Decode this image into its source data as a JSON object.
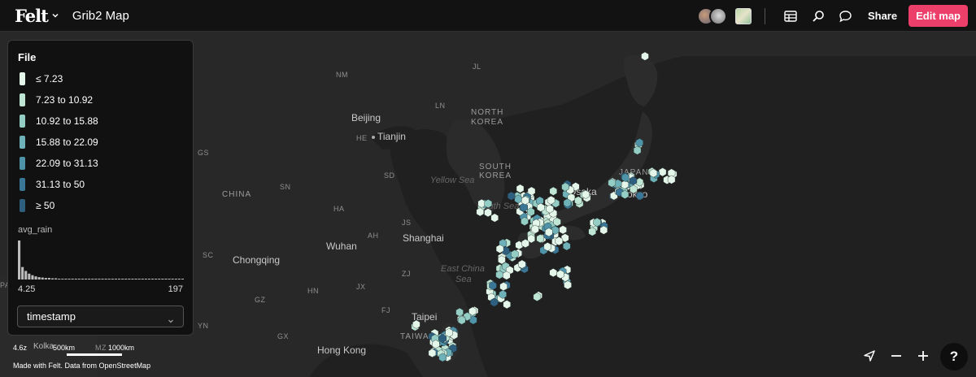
{
  "topbar": {
    "brand": "Felt",
    "title": "Grib2 Map",
    "share_label": "Share",
    "edit_label": "Edit map",
    "accent_color": "#ec3f6a",
    "icons": [
      "table-icon",
      "search-icon",
      "comment-icon"
    ]
  },
  "legend": {
    "title": "File",
    "items": [
      {
        "label": "≤ 7.23",
        "color": "#e4f6e9"
      },
      {
        "label": "7.23 to 10.92",
        "color": "#bfe5d4"
      },
      {
        "label": "10.92 to 15.88",
        "color": "#93cdc4"
      },
      {
        "label": "15.88 to 22.09",
        "color": "#6fb1b8"
      },
      {
        "label": "22.09 to 31.13",
        "color": "#4e93a8"
      },
      {
        "label": "31.13 to 50",
        "color": "#3a7796"
      },
      {
        "label": "≥ 50",
        "color": "#2e5f7e"
      }
    ],
    "histogram": {
      "title": "avg_rain",
      "min": "4.25",
      "max": "197",
      "bin_heights": [
        1.0,
        0.32,
        0.22,
        0.15,
        0.11,
        0.08,
        0.06,
        0.05,
        0.04,
        0.04,
        0.03,
        0.03,
        0.02,
        0.02,
        0.02,
        0.02,
        0.02,
        0.01,
        0.01,
        0.01,
        0.01,
        0.01,
        0.01,
        0.01,
        0.01,
        0.01,
        0.01,
        0.01,
        0.01,
        0.01,
        0.01,
        0.01,
        0.01,
        0.01,
        0.01,
        0.01,
        0.01,
        0.01,
        0.01,
        0.01,
        0.01,
        0.01,
        0.01,
        0.01,
        0.01,
        0.01,
        0.01,
        0.01,
        0.01,
        0.01
      ]
    },
    "select_value": "timestamp"
  },
  "map": {
    "labels": {
      "nm": "NM",
      "jl": "JL",
      "ln": "LN",
      "beijing": "Beijing",
      "he": "HE",
      "tianjin": "Tianjin",
      "north_korea_1": "NORTH",
      "north_korea_2": "KOREA",
      "gs": "GS",
      "sd": "SD",
      "yellow_sea": "Yellow Sea",
      "south_korea_1": "SOUTH",
      "south_korea_2": "KOREA",
      "china": "CHINA",
      "sn": "SN",
      "ha": "HA",
      "js": "JS",
      "south_sea": "South Sea",
      "osaka": "Osaka",
      "tokyo": "Tokyo",
      "japan": "JAPAN",
      "shanghai": "Shanghai",
      "ah": "AH",
      "wuhan": "Wuhan",
      "sc": "SC",
      "chongqing": "Chongqing",
      "zj": "ZJ",
      "east_china_sea_1": "East China",
      "east_china_sea_2": "Sea",
      "hn": "HN",
      "jx": "JX",
      "gz": "GZ",
      "fj": "FJ",
      "taipei": "Taipei",
      "taiwan": "TAIWAN",
      "yn": "YN",
      "gx": "GX",
      "hong_kong": "Hong Kong",
      "pa": "PA",
      "kolkata": "Kolka"
    },
    "scale": {
      "zoom": "4.6z",
      "small": "500km",
      "large": "1000km",
      "mz": "MZ"
    },
    "attribution": "Made with Felt. Data from OpenStreetMap",
    "land_color": "#2b2b2b",
    "sea_color": "#202020"
  }
}
